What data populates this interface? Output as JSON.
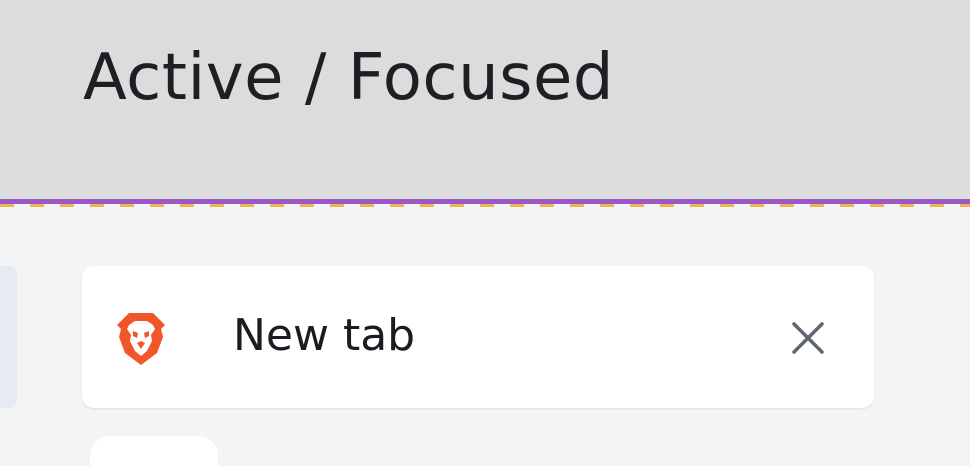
{
  "header": {
    "title": "Active / Focused"
  },
  "tab": {
    "title": "New tab",
    "favicon_icon": "brave-lion-icon",
    "close_icon": "close-icon"
  },
  "colors": {
    "header_bg": "#dcdcdc",
    "page_bg": "#f3f4f6",
    "divider": "#9b59c4",
    "divider_dashes": "#f0a93a",
    "tab_bg": "#ffffff",
    "favicon_orange": "#f1562b",
    "close_icon": "#5f6672"
  }
}
